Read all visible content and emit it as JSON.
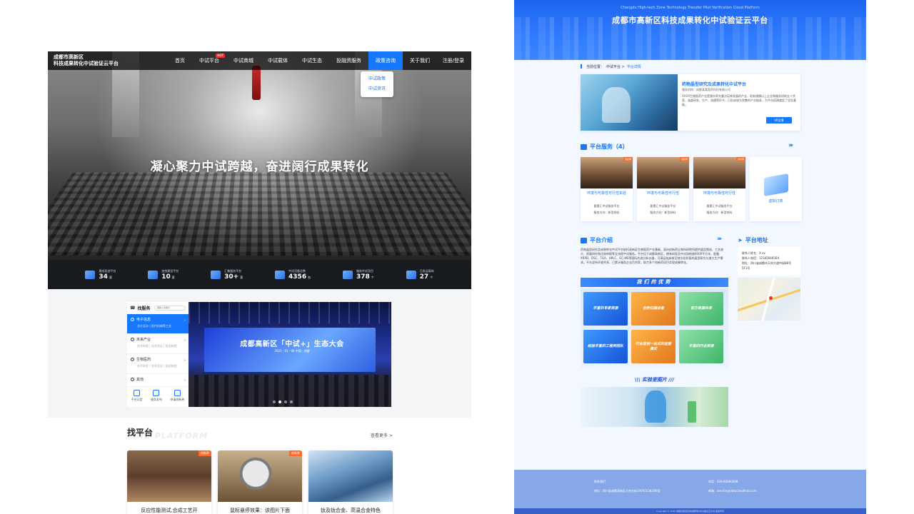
{
  "left": {
    "logo": {
      "line1": "成都市高新区",
      "line2": "科技成果转化中试验证云平台"
    },
    "nav": [
      {
        "label": "首页"
      },
      {
        "label": "中试平台",
        "badge": "HOT"
      },
      {
        "label": "中试商城"
      },
      {
        "label": "中试载体"
      },
      {
        "label": "中试生态"
      },
      {
        "label": "投融资服务"
      },
      {
        "label": "政策咨询",
        "active": true
      },
      {
        "label": "关于我们"
      }
    ],
    "login": "注册/登录",
    "dropdown": [
      "中试政策",
      "中试资讯"
    ],
    "slogan": "凝心聚力中试跨越，奋进阔行成果转化",
    "stats": [
      {
        "icon": "building-icon",
        "label": "建成双创平台",
        "value": "34",
        "unit": "家"
      },
      {
        "icon": "platform-icon",
        "label": "加快建设平台",
        "value": "10",
        "unit": "家"
      },
      {
        "icon": "cube-icon",
        "label": "汇集服务平台",
        "value": "30+",
        "unit": "家"
      },
      {
        "icon": "device-icon",
        "label": "中试设备总数",
        "value": "4356",
        "unit": "台"
      },
      {
        "icon": "service-icon",
        "label": "服务中试项目",
        "value": "378",
        "unit": "个"
      },
      {
        "icon": "carrier-icon",
        "label": "已投运载体",
        "value": "27",
        "unit": "个"
      }
    ],
    "service": {
      "title": "找服务",
      "search_placeholder": "请输入关键词",
      "categories": [
        {
          "title": "电子信息",
          "sub": "芯片设计 | 医疗机械等工业",
          "active": true
        },
        {
          "title": "未来产业",
          "sub": "技术研发 | 技术验证 | 轻创制造"
        },
        {
          "title": "生物医药",
          "sub": "技术研发 | 技术验证 | 轻创制造"
        },
        {
          "title": "其他",
          "sub": ""
        }
      ],
      "actions": [
        {
          "label": "平台认定",
          "icon": "user-icon"
        },
        {
          "label": "服务发布",
          "icon": "send-icon"
        },
        {
          "label": "申请创新券",
          "icon": "ticket-icon"
        }
      ]
    },
    "banner": {
      "title": "成都高新区「中试+」生态大会",
      "date": "2025 · 03 · 06    中国 · 成都"
    },
    "find_platform": {
      "title": "找平台",
      "en": "FIND PLATFORM",
      "more": "查看更多 >"
    },
    "cards": [
      {
        "title": "反应性能测试,合成工艺开",
        "tag": "创新券"
      },
      {
        "title": "鼠标悬停效果：该图片下面",
        "tag": "创新券"
      },
      {
        "title": "钛及钛合金、高温合金特色",
        "tag": "创新券"
      }
    ]
  },
  "right": {
    "header": {
      "en": "Chengdu High-tech Zone Technology Transfer Pilot Verification Cloud Platform",
      "zh": "成都市高新区科技成果转化中试验证云平台"
    },
    "breadcrumb": {
      "prefix": "当前位置：",
      "parent": "中试平台 >",
      "current": "平台详情"
    },
    "intro": {
      "title": "药物晶型研究及成果转化中试平台",
      "org": "服务机构：成都某某医药科技有限公司",
      "desc": "XXXX生物医药产业是我市率先重点培育发展的产业，现有规模以上企业和服务机构五十余家，涵盖研发、生产、流通等环节，已形成较为完整的产业链条，为平台搭建奠定了坚实基础。",
      "vr": "VR全景"
    },
    "services_title": "平台服务（4）",
    "services": [
      {
        "name": "环境与可靠性可行性实验",
        "price": "要素汇中试服务平台",
        "field": "服务方向：新型材料",
        "tag": "创新券"
      },
      {
        "name": "环境与可靠性可行性",
        "price": "要素汇中试服务平台",
        "field": "服务方向：新型材料",
        "tag": "创新券"
      },
      {
        "name": "环境与可靠性可行性",
        "price": "要素汇中试服务平台",
        "field": "服务方向：新型材料",
        "tag": "创新券"
      }
    ],
    "virtual_label": "虚拟订单",
    "about_title": "平台介绍",
    "about_text": "药物晶型研究及成果转化中试平台依托高新区生物医药产业基础，面向创新药企和科研院所提供晶型筛选、工艺放大、质量研究和注册申报等全流程中试服务。平台位于成都高新区，拥有研发及中试场地逾6000平方米，配备XRPD、DSC、TGA、HPLC、GC-MS等国际先进分析仪器，可满足临床前至商业化阶段的晶型研究与放大生产需求。平台坚持开放共享，已累计服务企业百余家，助力多个创新药项目实现成果转化。",
    "advantages_title": "我们的优势",
    "advantages": [
      {
        "label": "丰富的专家资源",
        "tone": "b"
      },
      {
        "label": "全新仪器设备",
        "tone": "o"
      },
      {
        "label": "官方资源共享",
        "tone": "g"
      },
      {
        "label": "经验丰富的工程师团队",
        "tone": "b"
      },
      {
        "label": "行业首创一站式的运营模式",
        "tone": "o"
      },
      {
        "label": "丰富的行业资源",
        "tone": "g"
      }
    ],
    "lab_title": "实验室图片",
    "address_title": "平台地址",
    "address": {
      "contact": "联系人姓名：X xx",
      "phone": "联系人电话：12345646564",
      "addr": "地址：四川省成都市天府大道中段88号5F1号"
    },
    "footer": {
      "contact_us": "联系我们",
      "address": "地址：四川省成都高新区天府五街200号1C栋306室",
      "phone": "电话：028-82880088",
      "email": "邮箱：service@datacloudhub.com",
      "copyright": "Copyright © 2025 成都高新区科技成果转化中试验证云平台 版权所有"
    }
  },
  "colors": {
    "brand_blue": "#1677ff",
    "hot_orange": "#ff6a2b",
    "nav_dark": "#1c1c1c"
  }
}
